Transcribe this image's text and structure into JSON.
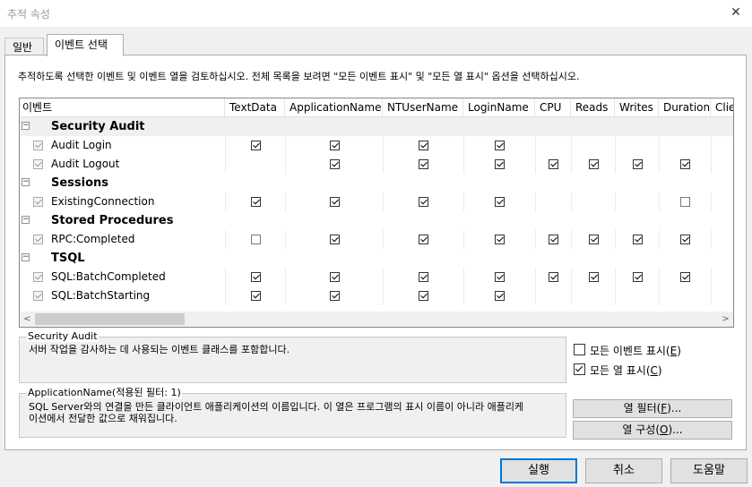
{
  "window": {
    "title": "추적 속성",
    "close_label": "✕"
  },
  "tabs": [
    {
      "label": "일반"
    },
    {
      "label": "이벤트 선택"
    }
  ],
  "instruction": "추적하도록 선택한 이벤트 및 이벤트 열을 검토하십시오. 전체 목록을 보려면 \"모든 이벤트 표시\" 및 \"모든 열 표시\" 옵션을 선택하십시오.",
  "grid": {
    "columns": [
      "이벤트",
      "TextData",
      "ApplicationName",
      "NTUserName",
      "LoginName",
      "CPU",
      "Reads",
      "Writes",
      "Duration",
      "Clie"
    ],
    "collapse_glyph": "−",
    "categories": [
      {
        "name": "Security Audit",
        "events": [
          {
            "name": "Audit Login",
            "cells": [
              1,
              1,
              1,
              1,
              "",
              "",
              "",
              "",
              ""
            ]
          },
          {
            "name": "Audit Logout",
            "cells": [
              "",
              1,
              1,
              1,
              1,
              1,
              1,
              1,
              ""
            ]
          }
        ]
      },
      {
        "name": "Sessions",
        "events": [
          {
            "name": "ExistingConnection",
            "cells": [
              1,
              1,
              1,
              1,
              "",
              "",
              "",
              0,
              ""
            ]
          }
        ]
      },
      {
        "name": "Stored Procedures",
        "events": [
          {
            "name": "RPC:Completed",
            "cells": [
              0,
              1,
              1,
              1,
              1,
              1,
              1,
              1,
              ""
            ]
          }
        ]
      },
      {
        "name": "TSQL",
        "events": [
          {
            "name": "SQL:BatchCompleted",
            "cells": [
              1,
              1,
              1,
              1,
              1,
              1,
              1,
              1,
              ""
            ]
          },
          {
            "name": "SQL:BatchStarting",
            "cells": [
              1,
              1,
              1,
              1,
              "",
              "",
              "",
              "",
              ""
            ]
          }
        ]
      }
    ],
    "scroll_left": "<",
    "scroll_right": ">"
  },
  "event_desc": {
    "title": "Security Audit",
    "text": "서버 작업을 감사하는 데 사용되는 이벤트 클래스를 포함합니다."
  },
  "column_desc": {
    "title": "ApplicationName(적용된 필터: 1)",
    "line1": "SQL Server와의 연결을 만든 클라이언트 애플리케이션의 이름입니다. 이 열은 프로그램의 표시 이름이 아니라 애플리케",
    "line2": "이션에서 전달한 값으로 채워집니다."
  },
  "options": {
    "show_all_events": {
      "label": "모든 이벤트 표시(",
      "key": "E",
      "suffix": ")",
      "checked": false
    },
    "show_all_columns": {
      "label": "모든 열 표시(",
      "key": "C",
      "suffix": ")",
      "checked": true
    }
  },
  "buttons": {
    "column_filter": {
      "label": "열 필터(",
      "key": "F",
      "suffix": ")..."
    },
    "organize_columns": {
      "label": "열 구성(",
      "key": "O",
      "suffix": ")..."
    },
    "run": "실행",
    "cancel": "취소",
    "help": "도움말"
  }
}
